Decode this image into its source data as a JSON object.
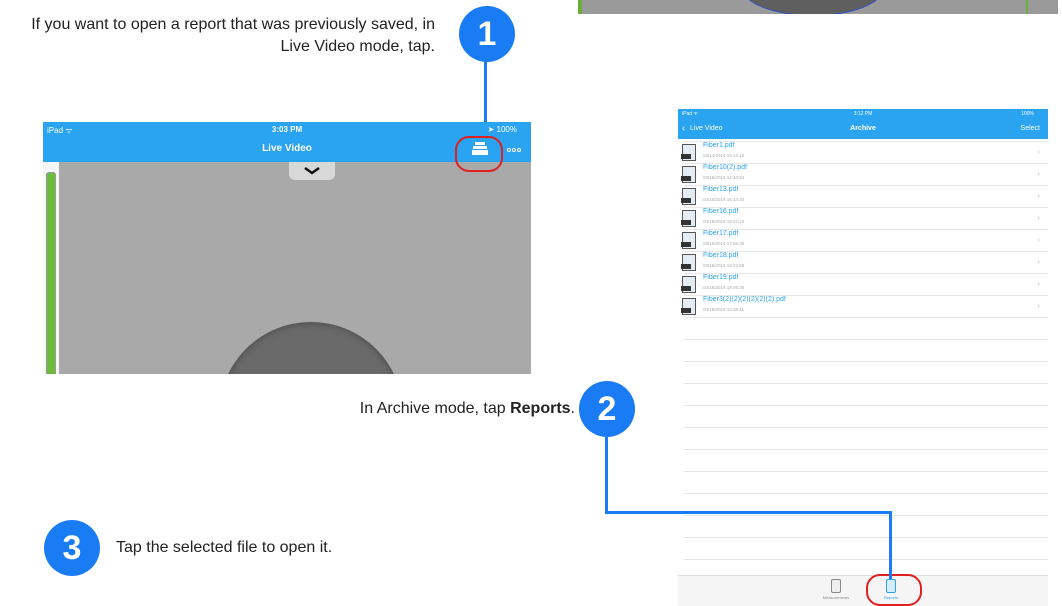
{
  "steps": {
    "step1": {
      "number": "1",
      "text": "If you want to open a report that was previously saved, in Live Video mode, tap."
    },
    "step2": {
      "number": "2",
      "text_prefix": "In Archive mode, tap ",
      "text_bold": "Reports",
      "text_suffix": "."
    },
    "step3": {
      "number": "3",
      "text": "Tap the selected file to open it."
    }
  },
  "colors": {
    "accent": "#1a7cf5",
    "highlight_ring": "#e02020",
    "app_bar": "#2aa3f0"
  },
  "live_video": {
    "status_left": "iPad ᯤ",
    "status_time": "3:03 PM",
    "status_right": "➤ 100%",
    "title": "Live Video",
    "archive_icon": "archive-icon",
    "more_icon": "more-icon"
  },
  "archive": {
    "status_left": "iPad ᯤ",
    "status_time": "3:12 PM",
    "status_right": "100%",
    "back_label": "Live Video",
    "title": "Archive",
    "select_label": "Select",
    "files": [
      {
        "name": "Fiber1.pdf",
        "date": "03/14/2016 15:13:10"
      },
      {
        "name": "Fiber10(2).pdf",
        "date": "03/15/2016 14:40:54"
      },
      {
        "name": "Fiber13.pdf",
        "date": "03/15/2016 15:14:34"
      },
      {
        "name": "Fiber16.pdf",
        "date": "03/15/2016 18:22:10"
      },
      {
        "name": "Fiber17.pdf",
        "date": "03/16/2016 17:56:38"
      },
      {
        "name": "Fiber18.pdf",
        "date": "03/16/2016 18:22:58"
      },
      {
        "name": "Fiber19.pdf",
        "date": "03/16/2016 19:05:35"
      },
      {
        "name": "Fiber3(2)(2)(2)(2)(2)(2).pdf",
        "date": "03/15/2016 14:38:11"
      }
    ],
    "tabs": {
      "measurements": "Measurements",
      "reports": "Reports"
    }
  }
}
